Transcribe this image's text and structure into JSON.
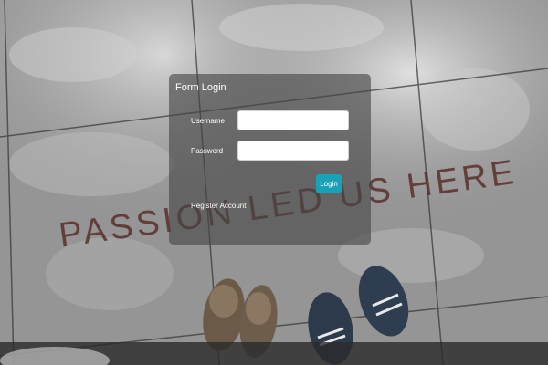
{
  "background": {
    "ground_text": "PASSION LED US HERE"
  },
  "form": {
    "title": "Form Login",
    "username_label": "Username",
    "username_value": "",
    "password_label": "Password",
    "password_value": "",
    "login_button": "Login",
    "register_link": "Register Account"
  },
  "colors": {
    "panel_overlay": "#464646",
    "login_button": "#17a2b8",
    "ground_text": "#5a2f2a"
  }
}
